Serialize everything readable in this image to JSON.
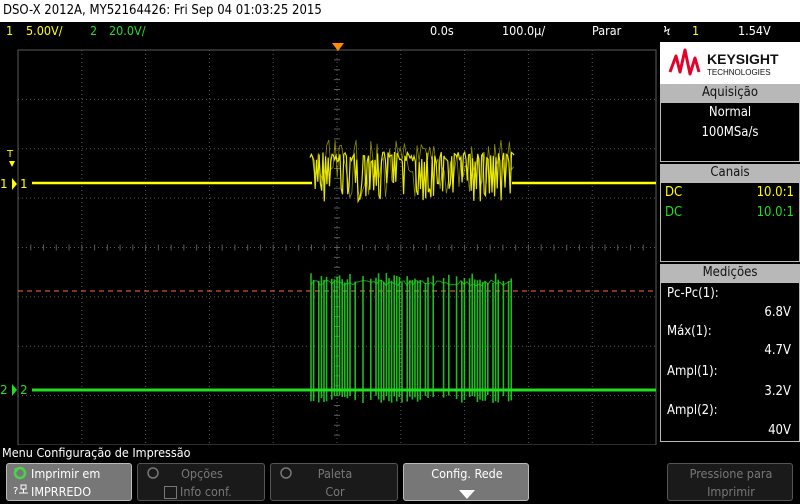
{
  "title": "DSO-X 2012A, MY52164426: Fri Sep 04 01:03:25 2015",
  "status": {
    "ch1_num": "1",
    "ch1_scale": "5.00V/",
    "ch2_num": "2",
    "ch2_scale": "20.0V/",
    "time_delay": "0.0s",
    "time_scale": "100.0µ/",
    "run_state": "Parar",
    "trig_symbol": "Ϟ",
    "trig_channel": "1",
    "trig_level": "1.54V"
  },
  "brand": {
    "name": "KEYSIGHT",
    "sub": "TECHNOLOGIES",
    "color": "#e4002b"
  },
  "acquisition": {
    "header": "Aquisição",
    "mode": "Normal",
    "rate": "100MSa/s"
  },
  "channels": {
    "header": "Canais",
    "items": [
      {
        "coupling": "DC",
        "probe": "10.0:1",
        "color": "#ffff00"
      },
      {
        "coupling": "DC",
        "probe": "10.0:1",
        "color": "#22dd22"
      }
    ]
  },
  "measurements": {
    "header": "Medições",
    "items": [
      {
        "label": "Pc-Pc(1):",
        "value": "6.8V"
      },
      {
        "label": "Máx(1):",
        "value": "4.7V"
      },
      {
        "label": "Ampl(1):",
        "value": "3.2V"
      },
      {
        "label": "Ampl(2):",
        "value": "40V"
      }
    ]
  },
  "markers": {
    "ch1": "1",
    "ch2": "2",
    "trigger": "T"
  },
  "menu_title": "Menu Configuração de Impressão",
  "softkeys": {
    "print_line1": "Imprimir em",
    "print_line2": "IMPRREDO",
    "options_line1": "Opções",
    "options_line2": "Info conf.",
    "palette_line1": "Paleta",
    "palette_line2": "Cor",
    "network_line1": "Config. Rede",
    "press_line1": "Pressione para",
    "press_line2": "Imprimir"
  },
  "colors": {
    "ch1": "#ffff00",
    "ch2": "#22dd22",
    "trigger_line": "#ff6a3d",
    "grid": "#5a5a5a",
    "trigger_marker": "#ff8c00"
  }
}
